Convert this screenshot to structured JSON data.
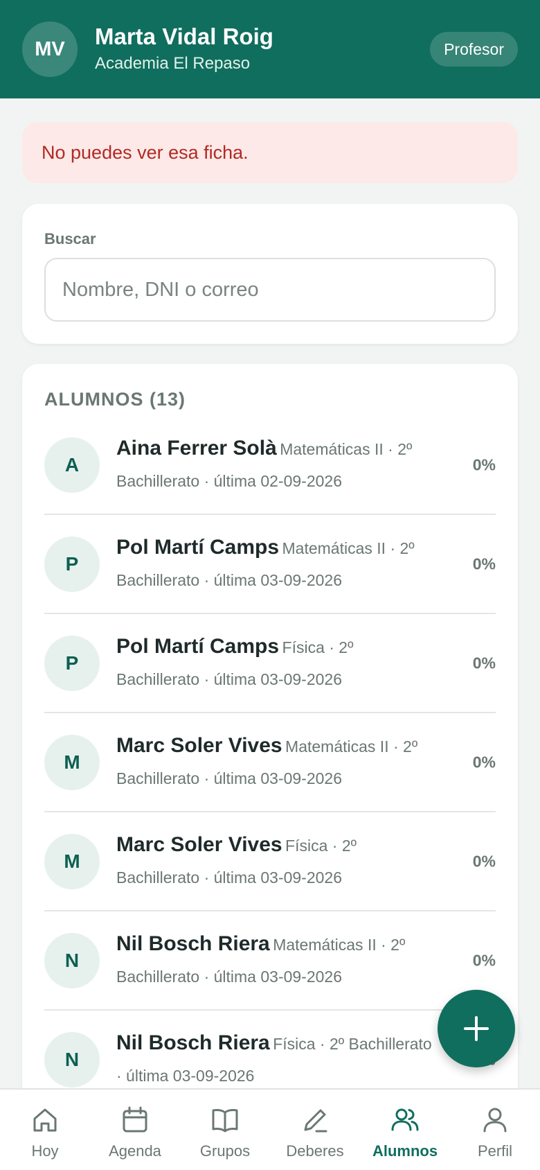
{
  "header": {
    "initials": "MV",
    "name": "Marta Vidal Roig",
    "organization": "Academia El Repaso",
    "role": "Profesor"
  },
  "alert": {
    "message": "No puedes ver esa ficha."
  },
  "search": {
    "label": "Buscar",
    "placeholder": "Nombre, DNI o correo",
    "value": ""
  },
  "list": {
    "title": "ALUMNOS (13)",
    "students": [
      {
        "initial": "A",
        "name": "Aina Ferrer Solà",
        "subject": "Matemáticas II · 2º",
        "meta": "Bachillerato · última 02-09-2026",
        "progress": "0%"
      },
      {
        "initial": "P",
        "name": "Pol Martí Camps",
        "subject": "Matemáticas II · 2º",
        "meta": "Bachillerato · última 03-09-2026",
        "progress": "0%"
      },
      {
        "initial": "P",
        "name": "Pol Martí Camps",
        "subject": "Física · 2º",
        "meta": "Bachillerato · última 03-09-2026",
        "progress": "0%"
      },
      {
        "initial": "M",
        "name": "Marc Soler Vives",
        "subject": "Matemáticas II · 2º",
        "meta": "Bachillerato · última 03-09-2026",
        "progress": "0%"
      },
      {
        "initial": "M",
        "name": "Marc Soler Vives",
        "subject": "Física · 2º",
        "meta": "Bachillerato · última 03-09-2026",
        "progress": "0%"
      },
      {
        "initial": "N",
        "name": "Nil Bosch Riera",
        "subject": "Matemáticas II · 2º",
        "meta": "Bachillerato · última 03-09-2026",
        "progress": "0%"
      },
      {
        "initial": "N",
        "name": "Nil Bosch Riera",
        "subject": "Física · 2º Bachillerato",
        "meta": "· última 03-09-2026",
        "progress": "0%"
      }
    ]
  },
  "fab": {
    "icon": "plus-icon"
  },
  "nav": {
    "items": [
      {
        "label": "Hoy",
        "icon": "home-icon"
      },
      {
        "label": "Agenda",
        "icon": "calendar-icon"
      },
      {
        "label": "Grupos",
        "icon": "book-icon"
      },
      {
        "label": "Deberes",
        "icon": "pencil-icon"
      },
      {
        "label": "Alumnos",
        "icon": "users-icon"
      },
      {
        "label": "Perfil",
        "icon": "user-icon"
      }
    ],
    "active": "Alumnos"
  },
  "colors": {
    "brand": "#106e5e",
    "alert_bg": "#fde9e7",
    "alert_text": "#b02a25"
  }
}
